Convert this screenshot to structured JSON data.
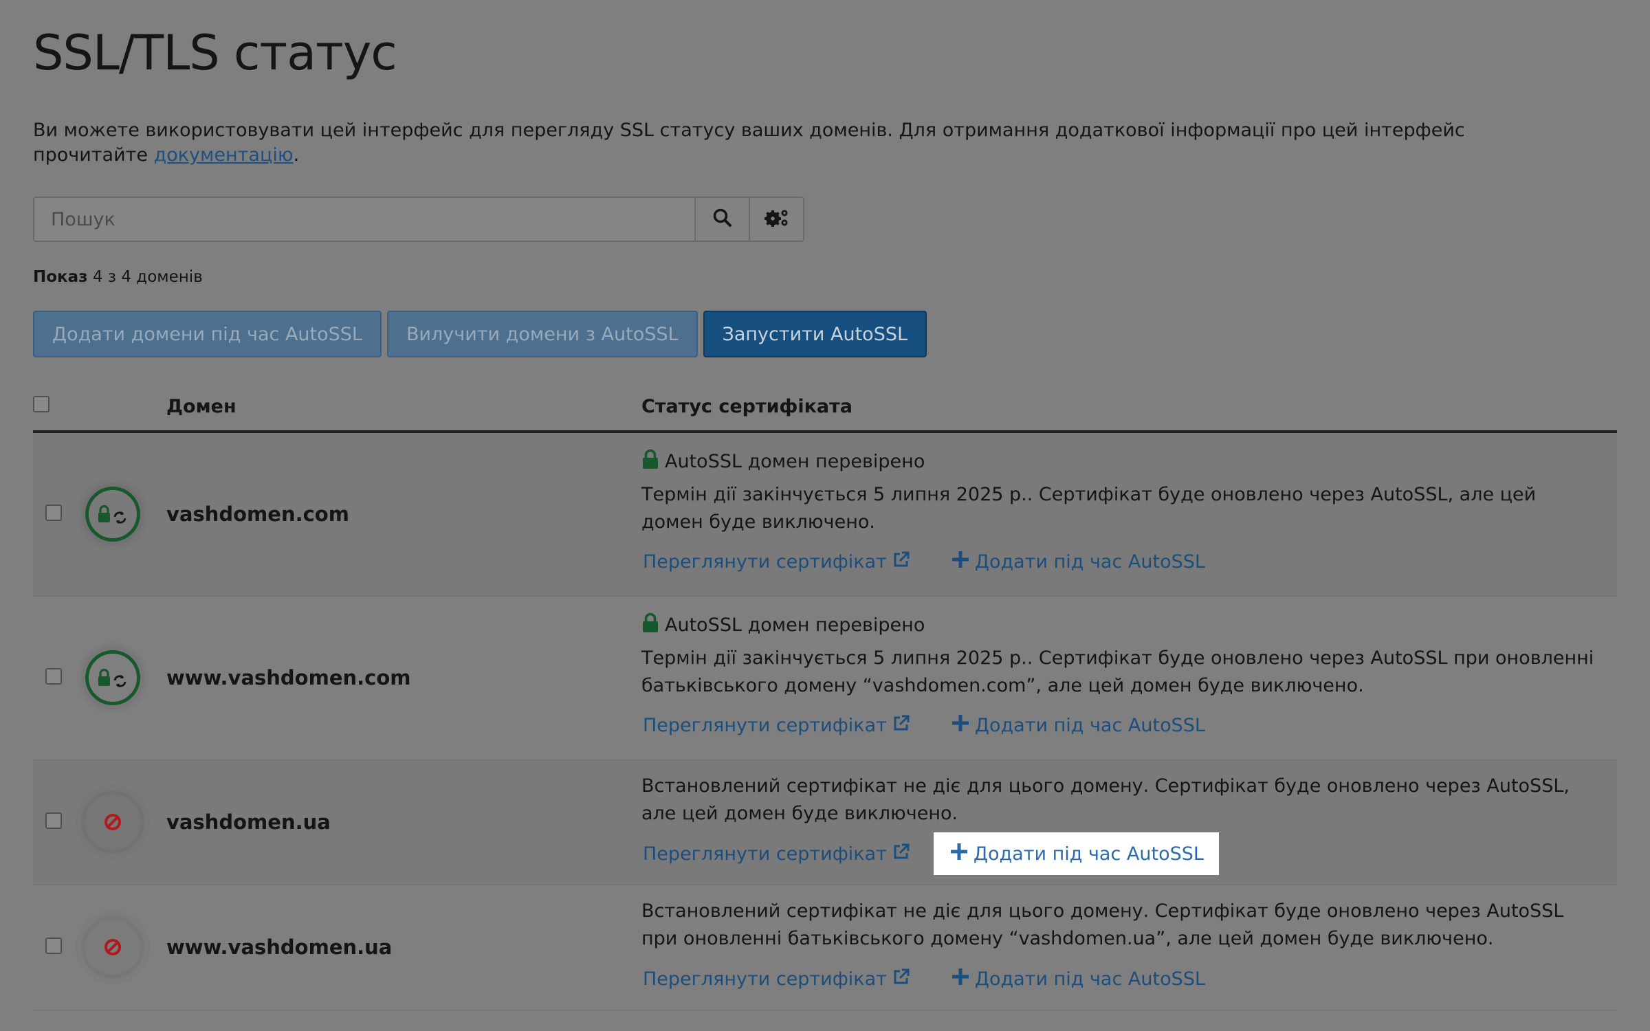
{
  "page": {
    "title": "SSL/TLS статус",
    "intro_text": "Ви можете використовувати цей інтерфейс для перегляду SSL статусу ваших доменів. Для отримання додаткової інформації про цей інтерфейс прочитайте ",
    "intro_link": "документацію",
    "intro_end": "."
  },
  "search": {
    "placeholder": "Пошук",
    "search_icon": "search-icon",
    "settings_icon": "gears-icon"
  },
  "count": {
    "label": "Показ",
    "value": "4 з 4 доменів"
  },
  "actions": {
    "add_label": "Додати домени під час AutoSSL",
    "exclude_label": "Вилучити домени з AutoSSL",
    "run_label": "Запустити AutoSSL"
  },
  "table": {
    "headers": {
      "domain": "Домен",
      "status": "Статус сертифіката"
    },
    "view_label": "Переглянути сертифікат",
    "add_label": "Додати під час AutoSSL",
    "rows": [
      {
        "domain": "vashdomen.com",
        "status_title": "AutoSSL домен перевірено",
        "status_text": "Термін дії закінчується 5 липня 2025 р.. Сертифікат буде оновлено через AutoSSL, але цей домен буде виключено."
      },
      {
        "domain": "www.vashdomen.com",
        "status_title": "AutoSSL домен перевірено",
        "status_text": "Термін дії закінчується 5 липня 2025 р.. Сертифікат буде оновлено через AutoSSL при оновленні батьківського домену “vashdomen.com”, але цей домен буде виключено."
      },
      {
        "domain": "vashdomen.ua",
        "status_text": "Встановлений сертифікат не діє для цього домену. Сертифікат буде оновлено через AutoSSL, але цей домен буде виключено."
      },
      {
        "domain": "www.vashdomen.ua",
        "status_text": "Встановлений сертифікат не діє для цього домену. Сертифікат буде оновлено через AutoSSL при оновленні батьківського домену “vashdomen.ua”, але цей домен буде виключено."
      }
    ]
  },
  "colors": {
    "overlay_bg": "#7f7f7f",
    "link": "#1b4e7d",
    "valid_green": "#17582c",
    "invalid_red": "#b01a1a",
    "highlight": "#ffffff"
  }
}
